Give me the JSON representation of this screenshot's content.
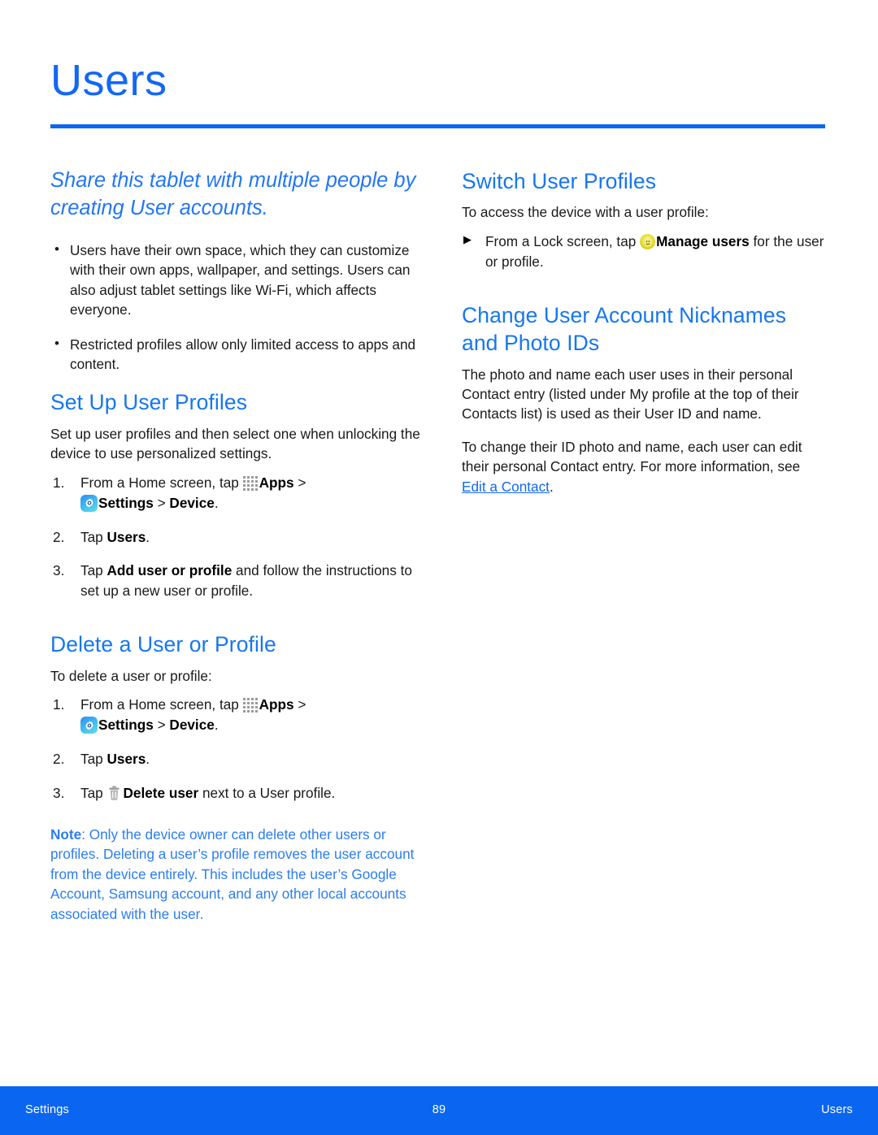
{
  "header": {
    "title": "Users",
    "rule_color": "#0a66f0"
  },
  "colors": {
    "heading_blue": "#1577f0",
    "lead_blue": "#2277f5",
    "note_blue": "#2a7df2",
    "link_blue": "#1268f5",
    "footer_blue": "#0a66f0"
  },
  "left_column": {
    "lead": "Share this tablet with multiple people by creating User accounts.",
    "bullets": [
      "Users have their own space, which they can customize with their own apps, wallpaper, and settings. Users can also adjust tablet settings like Wi-Fi, which affects everyone.",
      "Restricted profiles allow only limited access to apps and content."
    ],
    "set_up": {
      "heading": "Set Up User Profiles",
      "intro": "Set up user profiles and then select one when unlocking the device to use personalized settings.",
      "step1_pre": "From a Home screen, tap ",
      "step1_apps": "Apps",
      "step1_arrow1": " > ",
      "step1_settings": "Settings",
      "step1_arrow2": " > ",
      "step1_device": "Device",
      "step1_end": ".",
      "step2_pre": "Tap ",
      "step2_bold": "Users",
      "step2_end": ".",
      "step3_pre": "Tap ",
      "step3_bold": "Add user or profile",
      "step3_end": " and follow the instructions to set up a new user or profile."
    },
    "delete": {
      "heading": "Delete a User or Profile",
      "intro": "To delete a user or profile:",
      "step1_pre": "From a Home screen, tap ",
      "step1_apps": "Apps",
      "step1_arrow1": " > ",
      "step1_settings": "Settings",
      "step1_arrow2": " > ",
      "step1_device": "Device",
      "step1_end": ".",
      "step2_pre": "Tap ",
      "step2_bold": "Users",
      "step2_end": ".",
      "step3_pre": "Tap ",
      "step3_bold": "Delete user",
      "step3_end": " next to a User profile."
    },
    "note": {
      "label": "Note",
      "text": ": Only the device owner can delete other users or profiles. Deleting a user’s profile removes the user account from the device entirely. This includes the user’s Google Account, Samsung account, and any other local accounts associated with the user."
    }
  },
  "right_column": {
    "switch": {
      "heading": "Switch User Profiles",
      "intro": "To access the device with a user profile:",
      "bullet_pre": "From a Lock screen, tap ",
      "bullet_bold": "Manage users",
      "bullet_end": " for the user or profile."
    },
    "change": {
      "heading": "Change User Account Nicknames and Photo IDs",
      "para1": "The photo and name each user uses in their personal Contact entry (listed under My profile at the top of their Contacts list) is used as their User ID and name.",
      "para2_pre": "To change their ID photo and name, each user can edit their personal Contact entry. For more information, see ",
      "para2_link": "Edit a Contact",
      "para2_end": "."
    }
  },
  "icons": {
    "apps": "apps-grid-icon",
    "settings": "settings-gear-icon",
    "trash": "delete-trash-icon",
    "manage_users": "manage-users-face-icon"
  },
  "footer": {
    "left": "Settings",
    "page_number": "89",
    "right": "Users"
  }
}
